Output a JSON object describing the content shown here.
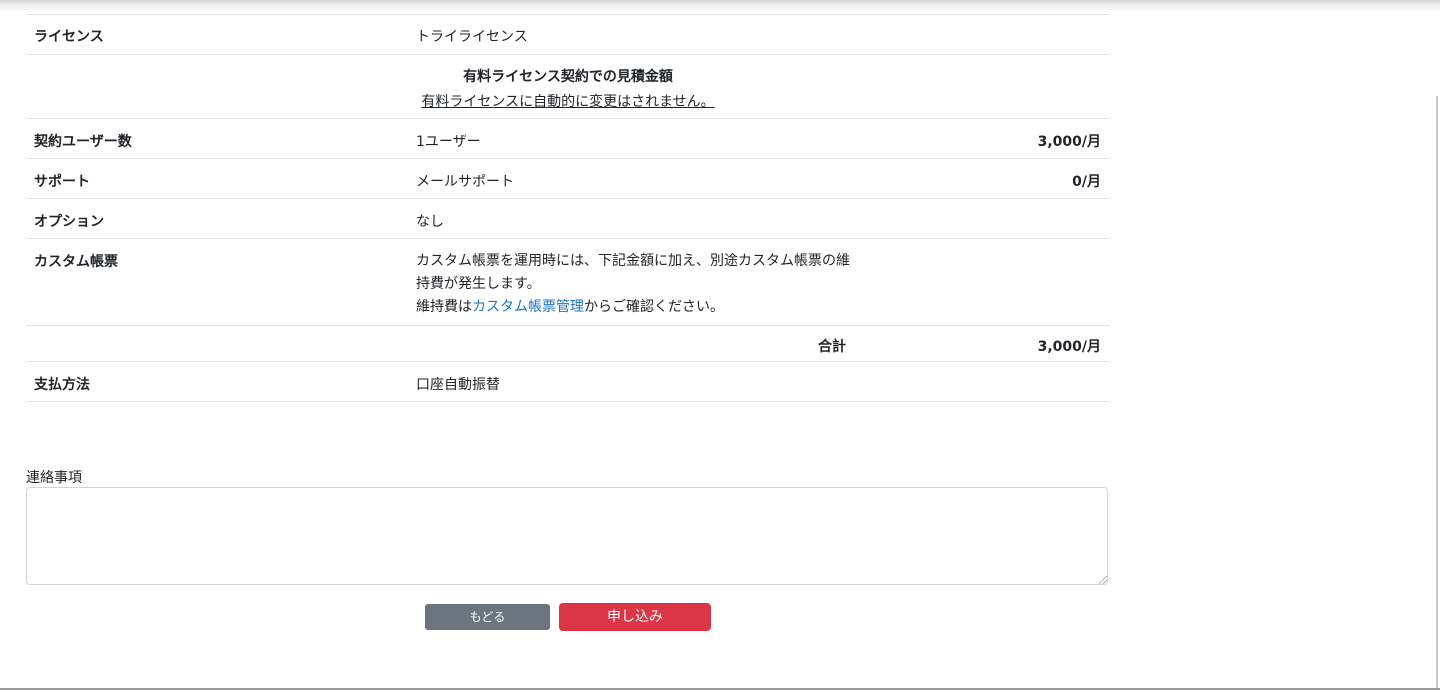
{
  "table": {
    "license": {
      "label": "ライセンス",
      "value": "トライライセンス"
    },
    "estimate_header": {
      "title": "有料ライセンス契約での見積金額",
      "note": "有料ライセンスに自動的に変更はされません。"
    },
    "users": {
      "label": "契約ユーザー数",
      "value": "1ユーザー",
      "price": "3,000/月"
    },
    "support": {
      "label": "サポート",
      "value": "メールサポート",
      "price": "0/月"
    },
    "option": {
      "label": "オプション",
      "value": "なし"
    },
    "custom_form": {
      "label": "カスタム帳票",
      "line1": "カスタム帳票を運用時には、下記金額に加え、別途カスタム帳票の維",
      "line2": "持費が発生します。",
      "line3_prefix": "維持費は",
      "line3_link": "カスタム帳票管理",
      "line3_suffix": "からご確認ください。"
    },
    "total": {
      "label": "合計",
      "price": "3,000/月"
    },
    "payment": {
      "label": "支払方法",
      "value": "口座自動振替"
    }
  },
  "remarks": {
    "label": "連絡事項",
    "value": ""
  },
  "buttons": {
    "back_label": "もどる",
    "apply_label": "申し込み"
  },
  "colors": {
    "apply": "#dc3545",
    "back": "#6c757d",
    "link": "#1a73c8"
  }
}
